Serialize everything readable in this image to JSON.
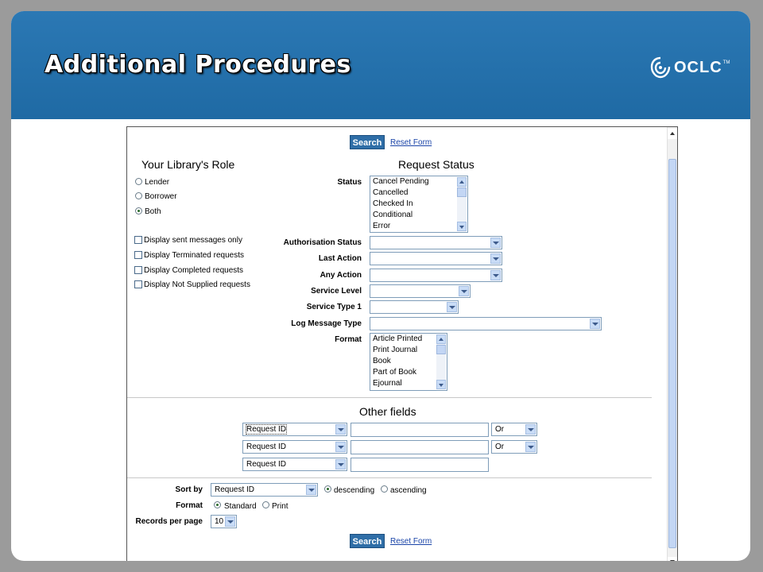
{
  "slide": {
    "title": "Additional Procedures",
    "logo_text": "OCLC",
    "logo_tm": "TM"
  },
  "form": {
    "search_label": "Search",
    "reset_label": "Reset Form",
    "role": {
      "heading": "Your Library's Role",
      "options": [
        {
          "label": "Lender",
          "selected": false
        },
        {
          "label": "Borrower",
          "selected": false
        },
        {
          "label": "Both",
          "selected": true
        }
      ],
      "checks": [
        {
          "label": "Display sent messages only",
          "checked": false
        },
        {
          "label": "Display Terminated requests",
          "checked": false
        },
        {
          "label": "Display Completed requests",
          "checked": false
        },
        {
          "label": "Display Not Supplied requests",
          "checked": false
        }
      ]
    },
    "request_status": {
      "heading": "Request Status",
      "status_label": "Status",
      "status_options": [
        "Cancel Pending",
        "Cancelled",
        "Checked In",
        "Conditional",
        "Error"
      ],
      "authorisation_label": "Authorisation Status",
      "authorisation_value": "",
      "last_action_label": "Last Action",
      "last_action_value": "",
      "any_action_label": "Any Action",
      "any_action_value": "",
      "service_level_label": "Service Level",
      "service_level_value": "",
      "service_type_label": "Service Type 1",
      "service_type_value": "",
      "log_message_label": "Log Message Type",
      "log_message_value": "",
      "format_label": "Format",
      "format_options": [
        "Article Printed",
        "Print Journal",
        "Book",
        "Part of Book",
        "Ejournal"
      ]
    },
    "other_fields": {
      "heading": "Other fields",
      "rows": [
        {
          "field": "Request ID",
          "value": "",
          "operator": "Or"
        },
        {
          "field": "Request ID",
          "value": "",
          "operator": "Or"
        },
        {
          "field": "Request ID",
          "value": ""
        }
      ]
    },
    "sort": {
      "sort_by_label": "Sort by",
      "sort_by_value": "Request ID",
      "descending_label": "descending",
      "ascending_label": "ascending",
      "order": "descending",
      "format_label": "Format",
      "standard_label": "Standard",
      "print_label": "Print",
      "format_selected": "Standard",
      "records_label": "Records per page",
      "records_value": "10"
    }
  }
}
